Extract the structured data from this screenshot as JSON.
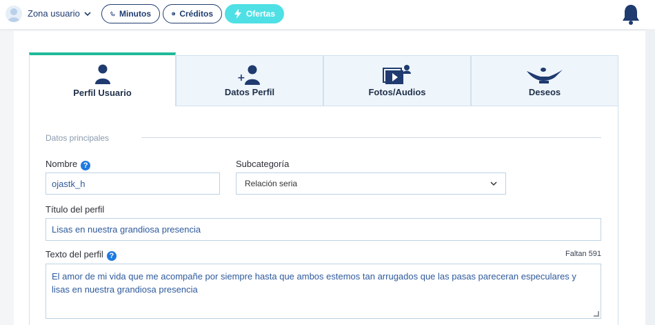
{
  "topbar": {
    "zone_label": "Zona usuario",
    "minutes_label": "Minutos",
    "credits_label": "Créditos",
    "offers_label": "Ofertas",
    "accent_color": "#4fe0e5",
    "brand_color": "#1f3b6f"
  },
  "tabs": [
    {
      "label": "Perfil Usuario",
      "icon": "user-icon",
      "active": true
    },
    {
      "label": "Datos Perfil",
      "icon": "user-plus-icon",
      "active": false
    },
    {
      "label": "Fotos/Audios",
      "icon": "video-user-icon",
      "active": false
    },
    {
      "label": "Deseos",
      "icon": "magic-lamp-icon",
      "active": false
    }
  ],
  "form": {
    "section_title": "Datos principales",
    "name_label": "Nombre",
    "name_value": "ojastk_h",
    "subcategory_label": "Subcategoría",
    "subcategory_value": "Relación seria",
    "profile_title_label": "Título del perfil",
    "profile_title_value": "Lisas en nuestra grandiosa presencia",
    "profile_text_label": "Texto del perfil",
    "remaining_label": "Faltan 591",
    "profile_text_value": "El amor de mi vida que me acompañe por siempre hasta que ambos estemos tan arrugados que las pasas pareceran especulares y lisas en nuestra grandiosa presencia"
  }
}
